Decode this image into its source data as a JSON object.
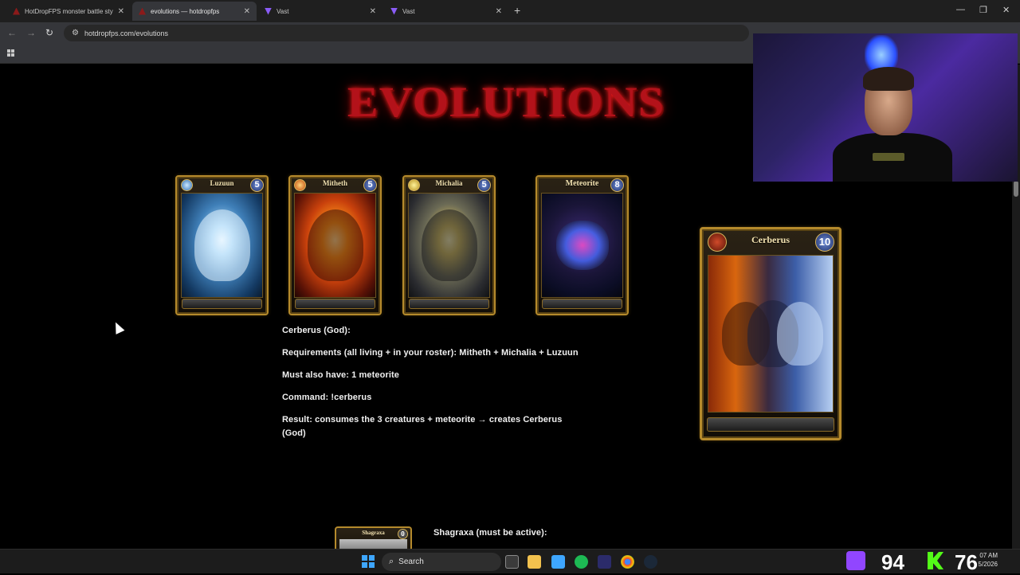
{
  "browser": {
    "tabs": [
      {
        "title": "HotDropFPS monster battle sty",
        "active": false
      },
      {
        "title": "evolutions — hotdropfps",
        "active": true
      },
      {
        "title": "Vast",
        "active": false
      },
      {
        "title": "Vast",
        "active": false
      }
    ],
    "new_tab_label": "+",
    "url": "hotdropfps.com/evolutions"
  },
  "page": {
    "title": "EVOLUTIONS",
    "cards": [
      {
        "name": "Luzuun",
        "cost": "5",
        "art": "ice"
      },
      {
        "name": "Mitheth",
        "cost": "5",
        "art": "fire"
      },
      {
        "name": "Michalia",
        "cost": "5",
        "art": "storm"
      },
      {
        "name": "Meteorite",
        "cost": "8",
        "art": "meteor"
      }
    ],
    "result_card": {
      "name": "Cerberus",
      "cost": "10"
    },
    "description": {
      "header": "Cerberus (God):",
      "requirements": "Requirements (all living + in your roster): Mitheth + Michalia + Luzuun",
      "must_have": "Must also have: 1 meteorite",
      "command": "Command: !cerberus",
      "result": "Result: consumes the 3 creatures + meteorite → creates Cerberus (God)"
    },
    "next": {
      "card_name": "Shagraxa",
      "card_cost": "0",
      "header": "Shagraxa (must be active):"
    }
  },
  "taskbar": {
    "search_placeholder": "Search",
    "overlay_left_number": "94",
    "overlay_right_number": "76",
    "clock_time": "07 AM",
    "clock_date": "5/2026"
  },
  "colors": {
    "title_red": "#b3121a",
    "card_gold": "#b58a2c",
    "twitch_purple": "#9146ff",
    "kick_green": "#53fc18",
    "windows_blue": "#3ea6ff"
  }
}
